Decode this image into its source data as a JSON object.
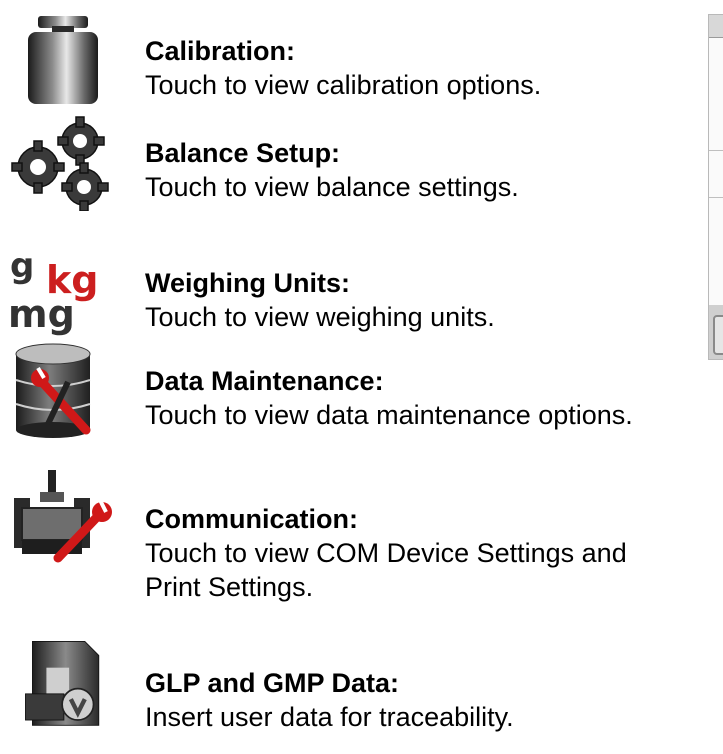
{
  "items": [
    {
      "icon": "calibration-weight-icon",
      "title": "Calibration:",
      "desc": "Touch to view calibration options."
    },
    {
      "icon": "gears-icon",
      "title": "Balance Setup:",
      "desc": "Touch to view balance settings."
    },
    {
      "icon": "weighing-units-icon",
      "title": "Weighing Units:",
      "desc": "Touch to view weighing units.",
      "unit_labels": [
        "g",
        "kg",
        "mg"
      ]
    },
    {
      "icon": "database-wrench-icon",
      "title": "Data Maintenance:",
      "desc": "Touch to view data maintenance options."
    },
    {
      "icon": "printer-wrench-icon",
      "title": "Communication:",
      "desc": "Touch to view COM Device Settings and",
      "desc2": "Print Settings."
    },
    {
      "icon": "glp-document-icon",
      "title": "GLP and GMP Data:",
      "desc": "Insert user data for traceability."
    }
  ],
  "colors": {
    "kg_red": "#cc1f1f",
    "wrench_red": "#d01818",
    "icon_dark": "#3a3a3a"
  }
}
